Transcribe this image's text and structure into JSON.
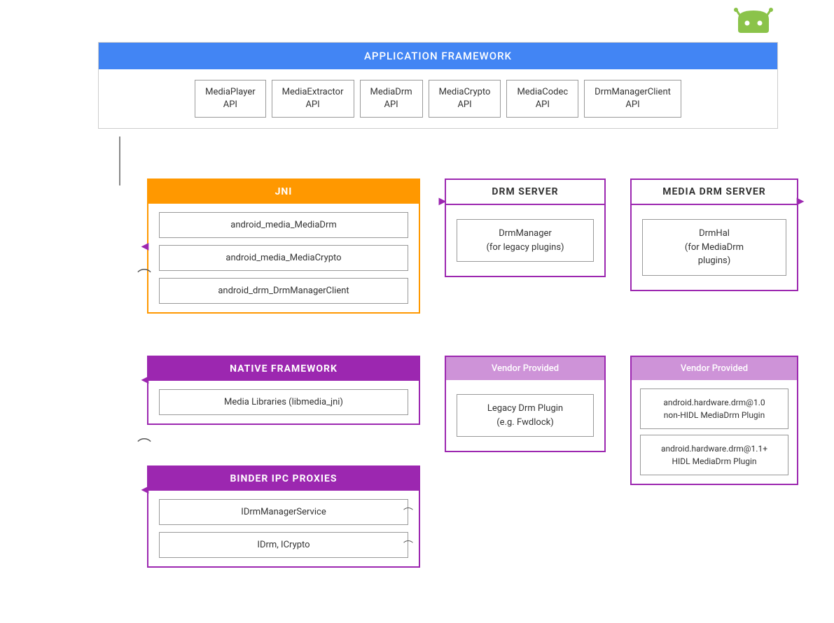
{
  "android_logo": {
    "alt": "Android Logo"
  },
  "app_framework": {
    "header": "APPLICATION FRAMEWORK",
    "apis": [
      {
        "label": "MediaPlayer\nAPI"
      },
      {
        "label": "MediaExtractor\nAPI"
      },
      {
        "label": "MediaDrm\nAPI"
      },
      {
        "label": "MediaCrypto\nAPI"
      },
      {
        "label": "MediaCodec\nAPI"
      },
      {
        "label": "DrmManagerClient\nAPI"
      }
    ]
  },
  "jni": {
    "header": "JNI",
    "items": [
      "android_media_MediaDrm",
      "android_media_MediaCrypto",
      "android_drm_DrmManagerClient"
    ]
  },
  "native_framework": {
    "header": "NATIVE FRAMEWORK",
    "items": [
      "Media Libraries (libmedia_jni)"
    ]
  },
  "binder_ipc": {
    "header": "BINDER IPC PROXIES",
    "items": [
      "IDrmManagerService",
      "IDrm, ICrypto"
    ]
  },
  "drm_server": {
    "header": "DRM SERVER",
    "items": [
      "DrmManager\n(for legacy plugins)"
    ]
  },
  "media_drm_server": {
    "header": "MEDIA DRM SERVER",
    "items": [
      "DrmHal\n(for MediaDrm\nplugins)"
    ]
  },
  "vendor_drm": {
    "header": "Vendor Provided",
    "items": [
      "Legacy Drm Plugin\n(e.g. Fwdlock)"
    ]
  },
  "vendor_media_drm": {
    "header": "Vendor Provided",
    "items": [
      "android.hardware.drm@1.0\nnon-HIDL MediaDrm Plugin",
      "android.hardware.drm@1.1+\nHIDL MediaDrm Plugin"
    ]
  },
  "colors": {
    "blue": "#4285f4",
    "orange": "#ff9800",
    "purple": "#9c27b0",
    "purple_light": "#ce93d8",
    "border_gray": "#999999"
  }
}
